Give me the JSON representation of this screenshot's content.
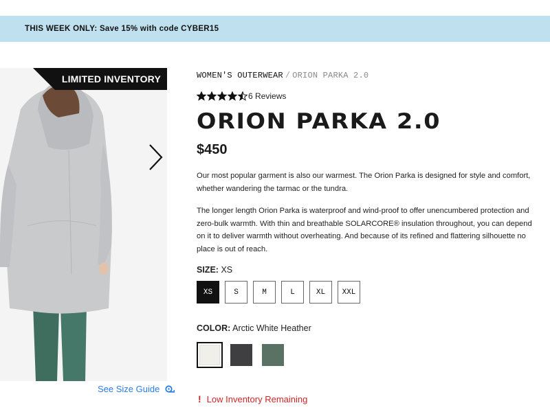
{
  "promo": {
    "text": "THIS WEEK ONLY: Save 15% with code CYBER15"
  },
  "gallery": {
    "badge": "LIMITED INVENTORY",
    "size_guide": "See Size Guide"
  },
  "breadcrumb": {
    "parent": "WOMEN'S OUTERWEAR",
    "separator": "/",
    "current": "ORION PARKA 2.0"
  },
  "rating": {
    "stars": 4.5,
    "reviews": "6 Reviews"
  },
  "product": {
    "title": "ORION PARKA 2.0",
    "price": "$450",
    "description": [
      "Our most popular garment is also our warmest. The Orion Parka is designed for style and comfort, whether wandering the tarmac or the tundra.",
      "The longer length Orion Parka is waterproof and wind-proof to offer unencumbered protection and zero-bulk warmth. With thin and breathable SOLARCORE® insulation throughout, you can depend on it to deliver warmth without overheating. And because of its refined and flattering silhouette no place is out of reach."
    ]
  },
  "size": {
    "label": "SIZE:",
    "selected": "XS",
    "options": [
      "XS",
      "S",
      "M",
      "L",
      "XL",
      "XXL"
    ]
  },
  "color": {
    "label": "COLOR:",
    "selected": "Arctic White Heather",
    "swatches": [
      {
        "name": "Arctic White Heather",
        "hex": "#f1efea"
      },
      {
        "name": "Charcoal",
        "hex": "#3f3f42"
      },
      {
        "name": "Green",
        "hex": "#597264"
      }
    ]
  },
  "warning": {
    "text": "Low Inventory Remaining"
  },
  "colors": {
    "promo_bg": "#bfe0ee",
    "link": "#2a7ce6",
    "warning": "#d12424"
  }
}
